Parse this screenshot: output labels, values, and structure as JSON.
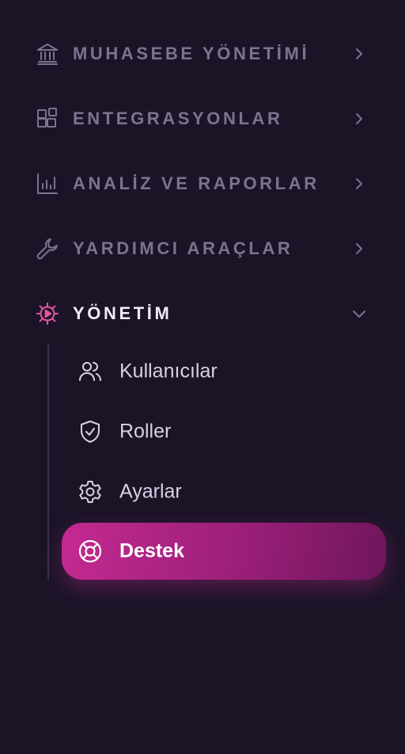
{
  "sidebar": {
    "sections": [
      {
        "label": "MUHASEBE YÖNETİMİ",
        "icon": "bank-icon",
        "expanded": false
      },
      {
        "label": "ENTEGRASYONLAR",
        "icon": "integrations-icon",
        "expanded": false
      },
      {
        "label": "ANALİZ VE RAPORLAR",
        "icon": "bar-chart-icon",
        "expanded": false
      },
      {
        "label": "YARDIMCI ARAÇLAR",
        "icon": "wrench-icon",
        "expanded": false
      },
      {
        "label": "YÖNETİM",
        "icon": "gear-play-icon",
        "expanded": true
      }
    ],
    "management_items": [
      {
        "label": "Kullanıcılar",
        "icon": "users-icon",
        "selected": false
      },
      {
        "label": "Roller",
        "icon": "shield-check-icon",
        "selected": false
      },
      {
        "label": "Ayarlar",
        "icon": "gear-icon",
        "selected": false
      },
      {
        "label": "Destek",
        "icon": "lifebuoy-icon",
        "selected": true
      }
    ]
  },
  "colors": {
    "background": "#1b1427",
    "muted_text": "#7e7290",
    "active_text": "#f2ecf7",
    "accent": "#c42a90",
    "accent_icon": "#e2559e",
    "sub_text": "#d9d0e4"
  }
}
